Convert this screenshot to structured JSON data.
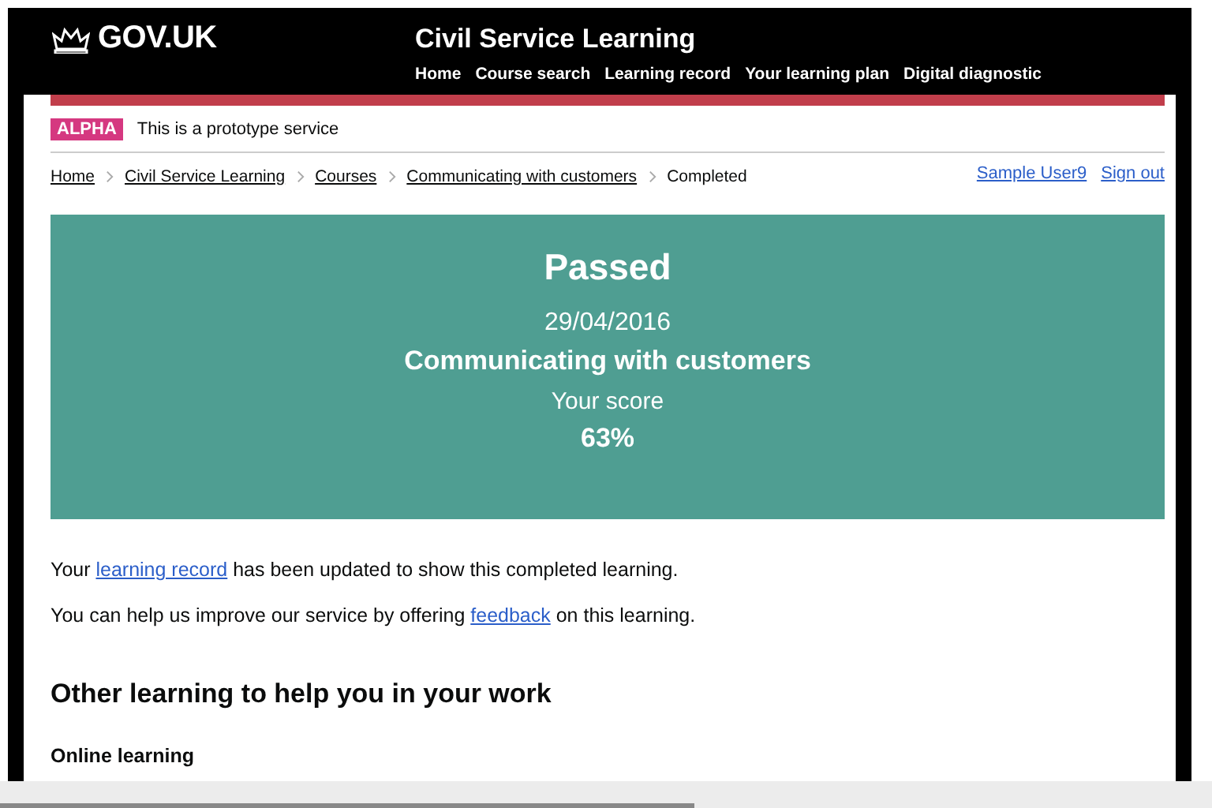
{
  "header": {
    "logo": "GOV.UK",
    "service_name": "Civil Service Learning",
    "nav": [
      {
        "label": "Home"
      },
      {
        "label": "Course search"
      },
      {
        "label": "Learning record"
      },
      {
        "label": "Your learning plan"
      },
      {
        "label": "Digital diagnostic"
      }
    ]
  },
  "phase_banner": {
    "tag": "ALPHA",
    "text": "This is a prototype service"
  },
  "breadcrumbs": [
    {
      "label": "Home",
      "link": true
    },
    {
      "label": "Civil Service Learning",
      "link": true
    },
    {
      "label": "Courses",
      "link": true
    },
    {
      "label": "Communicating with customers",
      "link": true
    },
    {
      "label": "Completed",
      "link": false
    }
  ],
  "account": [
    {
      "label": "Sample User9"
    },
    {
      "label": "Sign out"
    }
  ],
  "result_panel": {
    "title": "Passed",
    "date": "29/04/2016",
    "course": "Communicating with customers",
    "score_label": "Your score",
    "score": "63%"
  },
  "paragraphs": [
    {
      "before": "Your ",
      "link": "learning record",
      "after": " has been updated to show this completed learning."
    },
    {
      "before": "You can help us improve our service by offering ",
      "link": "feedback",
      "after": " on this learning."
    }
  ],
  "section_heading": "Other learning to help you in your work",
  "subheading": "Online learning"
}
